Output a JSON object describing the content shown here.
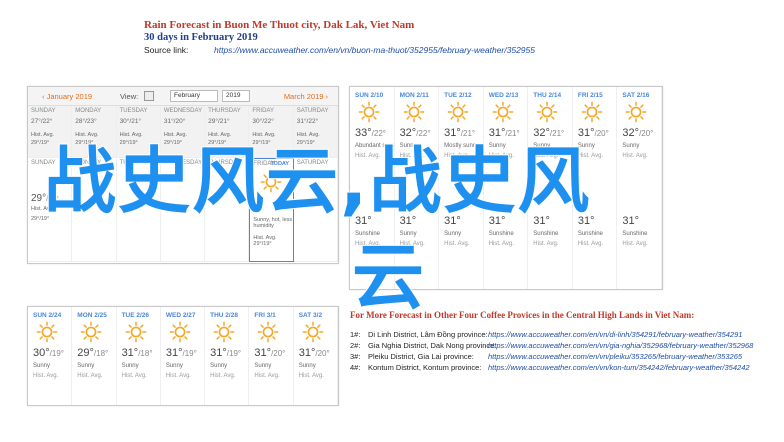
{
  "header": {
    "title": "Rain Forecast in Buon Me Thuot city, Dak Lak, Viet Nam",
    "subtitle": "30 days in February 2019",
    "source_label": "Source link:",
    "source_url": "https://www.accuweather.com/en/vn/buon-ma-thuot/352955/february-weather/352955"
  },
  "calendar": {
    "prev_month": "‹ January 2019",
    "view_label": "View:",
    "month_select": "February",
    "year_select": "2019",
    "next_month": "March 2019 ›",
    "weekdays": [
      "SUNDAY",
      "MONDAY",
      "TUESDAY",
      "WEDNESDAY",
      "THURSDAY",
      "FRIDAY",
      "SATURDAY"
    ],
    "row1": [
      {
        "t1": "27°/22°",
        "t2": "Hist. Avg.",
        "t3": "29°/19°"
      },
      {
        "t1": "28°/23°",
        "t2": "Hist. Avg.",
        "t3": "29°/19°"
      },
      {
        "t1": "30°/21°",
        "t2": "Hist. Avg.",
        "t3": "29°/19°"
      },
      {
        "t1": "31°/20°",
        "t2": "Hist. Avg.",
        "t3": "29°/19°"
      },
      {
        "t1": "29°/21°",
        "t2": "Hist. Avg.",
        "t3": "29°/19°"
      },
      {
        "t1": "30°/22°",
        "t2": "Hist. Avg.",
        "t3": "29°/19°"
      },
      {
        "t1": "31°/22°",
        "t2": "Hist. Avg.",
        "t3": "29°/19°"
      }
    ],
    "row2": [
      {
        "temp": "29°",
        "sub": "/19°",
        "t2": "Hist. Avg.",
        "t3": "29°/19°"
      },
      {
        "temp": "",
        "sub": "",
        "t2": "",
        "t3": ""
      },
      {
        "temp": "",
        "sub": "",
        "t2": "",
        "t3": ""
      },
      {
        "temp": "",
        "sub": "",
        "t2": "",
        "t3": ""
      },
      {
        "temp": "",
        "sub": "",
        "t2": "",
        "t3": ""
      },
      {
        "temp": "",
        "sub": "",
        "t2": "Sunny, hot, less humidity",
        "t3": "Hist. Avg. 29°/19°"
      },
      {
        "temp": "",
        "sub": "",
        "t2": "",
        "t3": ""
      }
    ],
    "today_label": "TODAY"
  },
  "forecast_top": {
    "days": [
      {
        "dow": "SUN 2/10",
        "temp": "33°",
        "sub": "/22°",
        "desc": "Abundant sunshine",
        "hist": "Hist. Avg."
      },
      {
        "dow": "MON 2/11",
        "temp": "32°",
        "sub": "/22°",
        "desc": "Sunny",
        "hist": "Hist. Avg."
      },
      {
        "dow": "TUE 2/12",
        "temp": "31°",
        "sub": "/21°",
        "desc": "Mostly sunny",
        "hist": "Hist. Avg."
      },
      {
        "dow": "WED 2/13",
        "temp": "31°",
        "sub": "/21°",
        "desc": "Sunny",
        "hist": "Hist. Avg."
      },
      {
        "dow": "THU 2/14",
        "temp": "32°",
        "sub": "/21°",
        "desc": "Sunny",
        "hist": "Hist. Avg."
      },
      {
        "dow": "FRI 2/15",
        "temp": "31°",
        "sub": "/20°",
        "desc": "Sunny",
        "hist": "Hist. Avg."
      },
      {
        "dow": "SAT 2/16",
        "temp": "32°",
        "sub": "/20°",
        "desc": "Sunny",
        "hist": "Hist. Avg."
      }
    ],
    "days2": [
      {
        "temp": "31°",
        "desc": "Sunshine",
        "hist": "Hist. Avg."
      },
      {
        "temp": "31°",
        "desc": "Sunny",
        "hist": "Hist. Avg."
      },
      {
        "temp": "31°",
        "desc": "Sunny",
        "hist": "Hist. Avg."
      },
      {
        "temp": "31°",
        "desc": "Sunshine",
        "hist": "Hist. Avg."
      },
      {
        "temp": "31°",
        "desc": "Sunshine",
        "hist": "Hist. Avg."
      },
      {
        "temp": "31°",
        "desc": "Sunshine",
        "hist": "Hist. Avg."
      },
      {
        "temp": "31°",
        "desc": "Sunshine",
        "hist": "Hist. Avg."
      }
    ]
  },
  "forecast_bottom": {
    "days": [
      {
        "dow": "SUN 2/24",
        "temp": "30°",
        "sub": "/19°",
        "desc": "Sunny",
        "hist": "Hist. Avg."
      },
      {
        "dow": "MON 2/25",
        "temp": "29°",
        "sub": "/18°",
        "desc": "Sunny",
        "hist": "Hist. Avg."
      },
      {
        "dow": "TUE 2/26",
        "temp": "31°",
        "sub": "/18°",
        "desc": "Sunny",
        "hist": "Hist. Avg."
      },
      {
        "dow": "WED 2/27",
        "temp": "31°",
        "sub": "/19°",
        "desc": "Sunny",
        "hist": "Hist. Avg."
      },
      {
        "dow": "THU 2/28",
        "temp": "31°",
        "sub": "/19°",
        "desc": "Sunny",
        "hist": "Hist. Avg."
      },
      {
        "dow": "FRI 3/1",
        "temp": "31°",
        "sub": "/20°",
        "desc": "Sunny",
        "hist": "Hist. Avg."
      },
      {
        "dow": "SAT 3/2",
        "temp": "31°",
        "sub": "/20°",
        "desc": "Sunny",
        "hist": "Hist. Avg."
      }
    ]
  },
  "watermark": {
    "line1": "战史风云,战史风",
    "line2": "云"
  },
  "more": {
    "title": "For More Forecast in Other Four Coffee Provices in the Central High Lands in Viet Nam:",
    "links": [
      {
        "num": "1#:",
        "name": "Di Linh District, Lâm Đồng province:",
        "url": "https://www.accuweather.com/en/vn/di-linh/354291/february-weather/354291"
      },
      {
        "num": "2#:",
        "name": "Gia Nghia District, Dak Nong province:",
        "url": "https://www.accuweather.com/en/vn/gia-nghia/352968/february-weather/352968"
      },
      {
        "num": "3#:",
        "name": "Pleiku District, Gia Lai province:",
        "url": "https://www.accuweather.com/en/vn/pleiku/353265/february-weather/353265"
      },
      {
        "num": "4#:",
        "name": "Kontum District, Kontum province:",
        "url": "https://www.accuweather.com/en/vn/kon-tum/354242/february-weather/354242"
      }
    ]
  },
  "colors": {
    "title_red": "#c0392b",
    "subtitle_blue": "#1f3f8a",
    "link_blue": "#1f4ea8",
    "watermark_blue": "#1e90f0",
    "sun_orange": "#f5a623"
  }
}
